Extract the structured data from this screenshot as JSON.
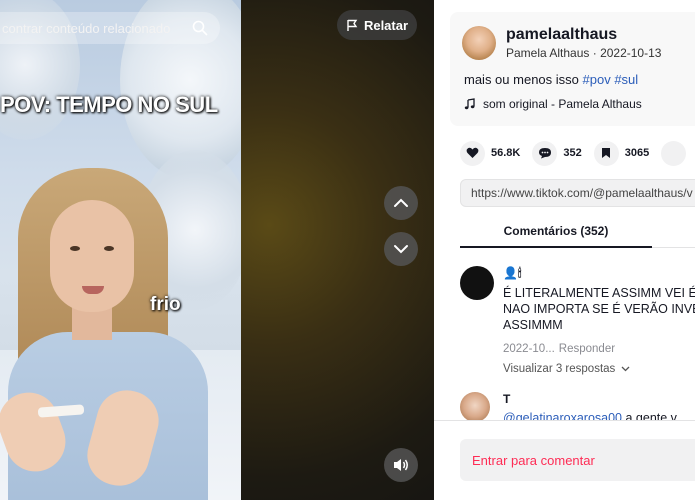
{
  "video": {
    "search_placeholder": "contrar conteúdo relacionado",
    "caption_top": "POV: TEMPO NO SUL",
    "caption_word": "frio",
    "report_label": "Relatar"
  },
  "post": {
    "username": "pamelaalthaus",
    "display_name": "Pamela Althaus",
    "separator": " · ",
    "date": "2022-10-13",
    "description_text": "mais ou menos isso ",
    "hashtags": [
      "#pov",
      "#sul"
    ],
    "music": "som original - Pamela Althaus"
  },
  "stats": {
    "likes": "56.8K",
    "comments": "352",
    "saves": "3065"
  },
  "share_url": "https://www.tiktok.com/@pamelaalthaus/v",
  "tabs": {
    "comments_label": "Comentários (352)"
  },
  "comments": [
    {
      "name": "👤🕯",
      "lines": [
        "É LITERALMENTE ASSIMM VEI É",
        "NAO IMPORTA SE É VERÃO INVE",
        "ASSIMMM"
      ],
      "date": "2022-10...",
      "reply_label": "Responder",
      "view_replies": "Visualizar 3 respostas"
    },
    {
      "name": "T",
      "mention": "@gelatinaroxarosa00",
      "text": " a gente v"
    }
  ],
  "comment_input_placeholder": "Entrar para comentar",
  "colors": {
    "hashtag": "#2b5db9",
    "accent": "#fe2c55",
    "text": "#161823"
  }
}
